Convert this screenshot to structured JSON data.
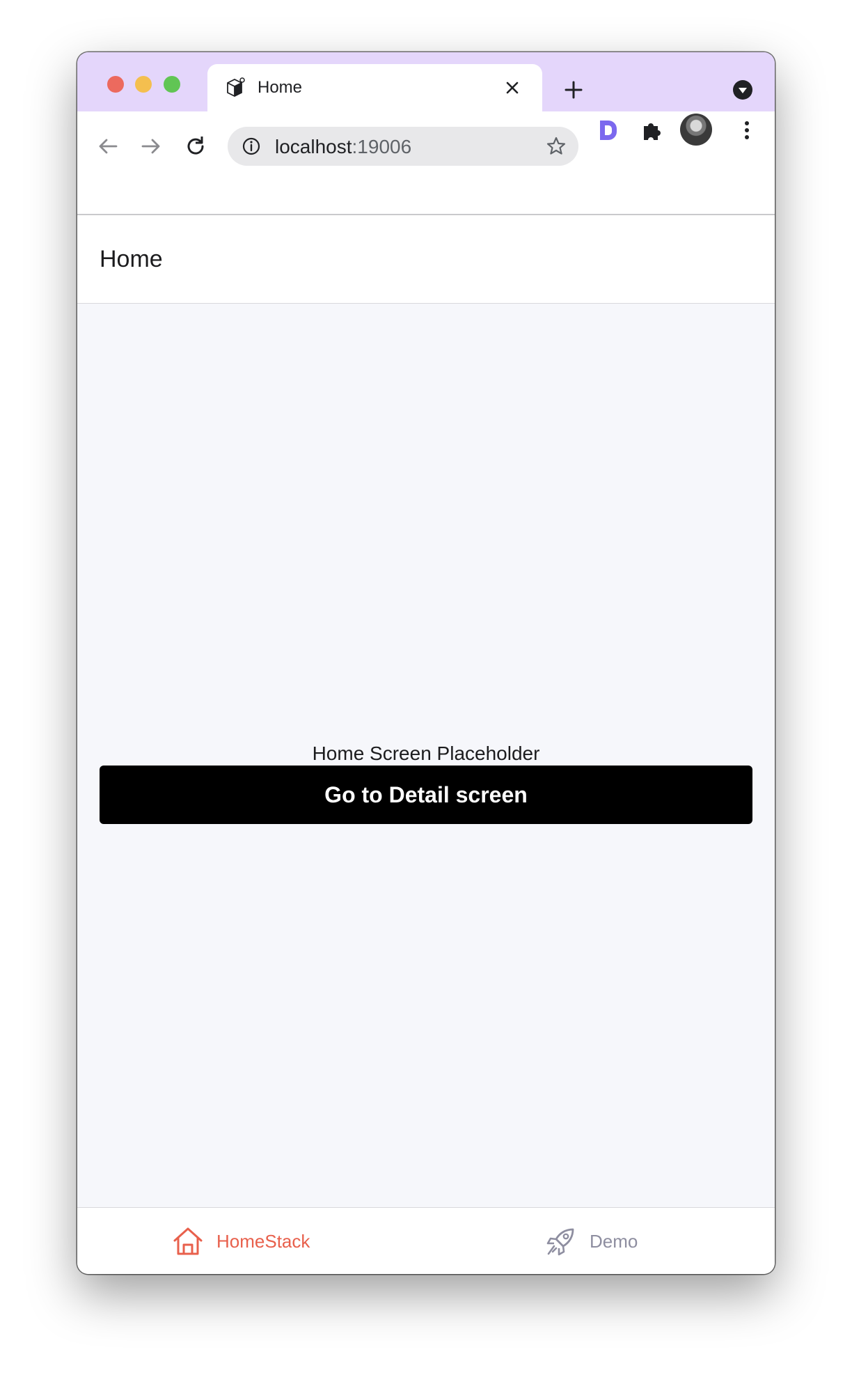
{
  "browser": {
    "tab": {
      "title": "Home",
      "favicon": "cube-favicon-icon"
    },
    "address": {
      "host": "localhost",
      "port": ":19006"
    },
    "colors": {
      "tabstrip": "#e4d6fb",
      "extension_accent": "#7b68ee"
    }
  },
  "app": {
    "header": {
      "title": "Home"
    },
    "content": {
      "placeholder": "Home Screen Placeholder",
      "button_label": "Go to Detail screen"
    },
    "tabbar": {
      "items": [
        {
          "label": "HomeStack",
          "icon": "home-icon",
          "active": true,
          "color": "#e8604c"
        },
        {
          "label": "Demo",
          "icon": "rocket-icon",
          "active": false,
          "color": "#8e8ea0"
        }
      ]
    }
  }
}
